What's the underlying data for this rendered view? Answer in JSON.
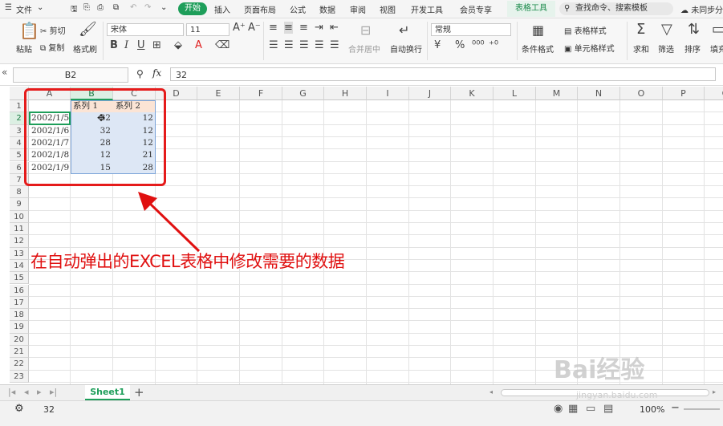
{
  "menu": {
    "file": "文件",
    "tabs": [
      "开始",
      "插入",
      "页面布局",
      "公式",
      "数据",
      "审阅",
      "视图",
      "开发工具",
      "会员专享",
      "表格工具"
    ],
    "search_placeholder": "查找命令、搜索模板",
    "sync": "未同步",
    "share": "分"
  },
  "ribbon": {
    "paste": "粘贴",
    "cut": "剪切",
    "copy": "复制",
    "format_painter": "格式刷",
    "font_name": "宋体",
    "font_size": "11",
    "bold": "B",
    "italic": "I",
    "underline": "U",
    "merge_center": "合并居中",
    "wrap_text": "自动换行",
    "number_format": "常规",
    "currency": "¥",
    "percent": "%",
    "conditional_format": "条件格式",
    "table_style": "表格样式",
    "cell_style": "单元格样式",
    "sum": "求和",
    "filter": "筛选",
    "sort": "排序",
    "fill": "填充"
  },
  "formula_bar": {
    "name_box": "B2",
    "fx": "fx",
    "value": "32"
  },
  "grid": {
    "columns": [
      "A",
      "B",
      "C",
      "D",
      "E",
      "F",
      "G",
      "H",
      "I",
      "J",
      "K",
      "L",
      "M",
      "N",
      "O",
      "P",
      "Q"
    ],
    "rows": [
      "1",
      "2",
      "3",
      "4",
      "5",
      "6",
      "7",
      "8",
      "9",
      "10",
      "11",
      "12",
      "13",
      "14",
      "15",
      "16",
      "17",
      "18",
      "19",
      "20",
      "21",
      "22",
      "23"
    ],
    "header_row": [
      "",
      "系列 1",
      "系列 2"
    ],
    "data": [
      [
        "2002/1/5",
        "32",
        "12"
      ],
      [
        "2002/1/6",
        "32",
        "12"
      ],
      [
        "2002/1/7",
        "28",
        "12"
      ],
      [
        "2002/1/8",
        "12",
        "21"
      ],
      [
        "2002/1/9",
        "15",
        "28"
      ]
    ]
  },
  "sheets": [
    "Sheet1"
  ],
  "add_sheet": "+",
  "status": {
    "value": "32",
    "zoom": "100%",
    "zoom_minus": "−"
  },
  "annotation": "在自动弹出的EXCEL表格中修改需要的数据",
  "watermark": "Bai经验",
  "watermark_sub": "jingyan.baidu.com",
  "colors": {
    "accent": "#1e9e5a",
    "annotation_red": "#e01010",
    "header_fill": "#fbe4d5",
    "data_fill": "#dde7f5",
    "selection_green": "#1e9e5a"
  }
}
